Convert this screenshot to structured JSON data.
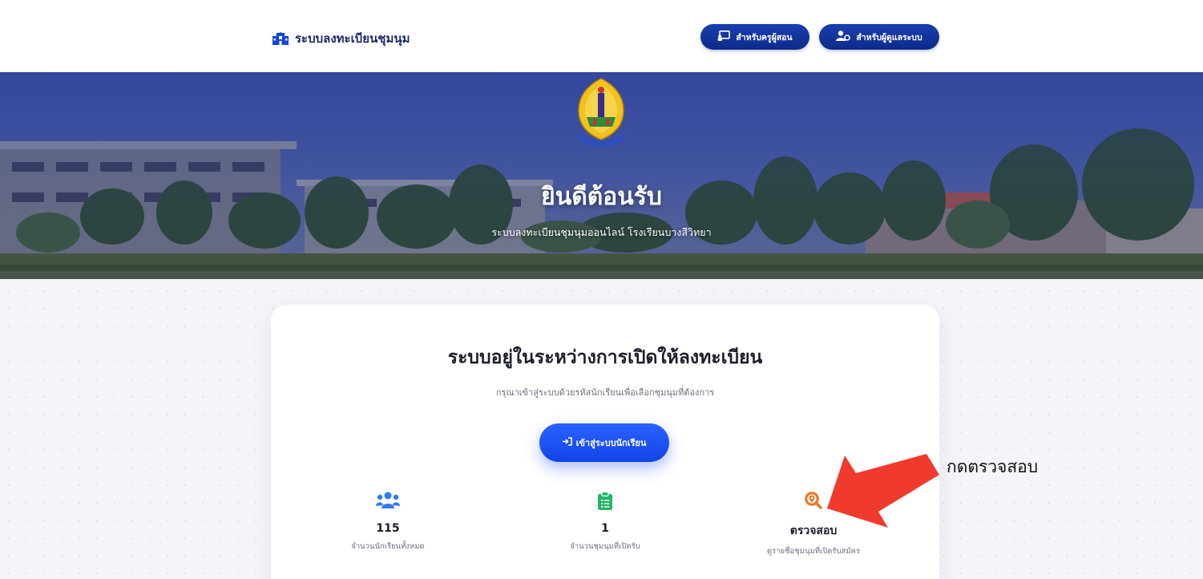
{
  "header": {
    "brand_label": "ระบบลงทะเบียนชุมนุม",
    "teacher_button": "สำหรับครูผู้สอน",
    "admin_button": "สำหรับผู้ดูแลระบบ"
  },
  "hero": {
    "logo_text": "โรงเรียนบางสีวิทยา",
    "title": "ยินดีต้อนรับ",
    "subtitle": "ระบบลงทะเบียนชุมนุมออนไลน์ โรงเรียนบางสีวิทยา"
  },
  "card": {
    "title": "ระบบอยู่ในระหว่างการเปิดให้ลงทะเบียน",
    "subtitle": "กรุณาเข้าสู่ระบบด้วยรหัสนักเรียนเพื่อเลือกชุมนุมที่ต้องการ",
    "login_button": "เข้าสู่ระบบนักเรียน"
  },
  "stats": [
    {
      "value": "115",
      "label": "จำนวนนักเรียนทั้งหมด",
      "icon": "users-icon",
      "color": "#2f7df6"
    },
    {
      "value": "1",
      "label": "จำนวนชุมนุมที่เปิดรับ",
      "icon": "clipboard-list-icon",
      "color": "#22b566"
    },
    {
      "value": "ตรวจสอบ",
      "label": "ดูรายชื่อชุมนุมที่เปิดรับสมัคร",
      "icon": "search-location-icon",
      "color": "#e8782a"
    }
  ],
  "annotation": {
    "text": "กดตรวจสอบ",
    "arrow_color": "#f03a2e"
  },
  "colors": {
    "primary": "#1243e6",
    "header_button": "#0d2a8a"
  }
}
